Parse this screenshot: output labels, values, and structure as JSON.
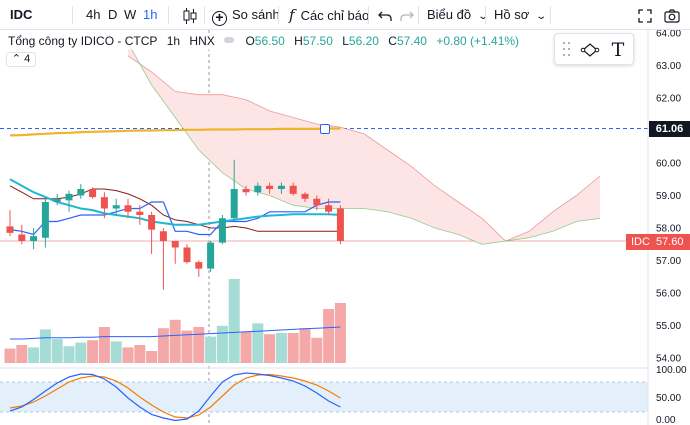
{
  "toolbar": {
    "symbol": "IDC",
    "intervals": [
      "4h",
      "D",
      "W",
      "1h"
    ],
    "active_interval": "1h",
    "compare_label": "So sánh",
    "indicators_label": "Các chỉ báo",
    "chart_type_label": "Biểu đồ",
    "profile_label": "Hồ sơ"
  },
  "legend": {
    "title": "Tổng công ty IDICO - CTCP",
    "interval": "1h",
    "exchange": "HNX",
    "o_key": "O",
    "o_val": "56.50",
    "h_key": "H",
    "h_val": "57.50",
    "l_key": "L",
    "l_val": "56.20",
    "c_key": "C",
    "c_val": "57.40",
    "change": "+0.80 (+1.41%)",
    "collapse": "4"
  },
  "price_axis": [
    "64.00",
    "63.00",
    "62.00",
    "61.00",
    "60.00",
    "59.00",
    "58.00",
    "57.00",
    "56.00",
    "55.00",
    "54.00"
  ],
  "osc_axis": [
    "100.00",
    "50.00",
    "0.00"
  ],
  "badges": {
    "last_line": "61.06",
    "symbol": "IDC",
    "current": "57.60"
  },
  "colors": {
    "up": "#26a69a",
    "down": "#ef5350",
    "accent": "#2962ff",
    "cloud_red": "#fde5e5",
    "cloud_green": "#d9efe8",
    "ma_long": "#f0b429",
    "ma_short": "#1fb6d8",
    "tenkan": "#2962ff",
    "kijun": "#8b1a1a"
  },
  "chart_data": {
    "type": "candlestick",
    "candles": [
      {
        "o": 58.05,
        "h": 58.55,
        "l": 57.75,
        "c": 57.85
      },
      {
        "o": 57.8,
        "h": 58.1,
        "l": 57.5,
        "c": 57.6
      },
      {
        "o": 57.6,
        "h": 58.0,
        "l": 57.35,
        "c": 57.75
      },
      {
        "o": 57.7,
        "h": 58.9,
        "l": 57.4,
        "c": 58.8
      },
      {
        "o": 58.8,
        "h": 59.05,
        "l": 58.7,
        "c": 58.9
      },
      {
        "o": 58.85,
        "h": 59.15,
        "l": 58.5,
        "c": 59.05
      },
      {
        "o": 59.0,
        "h": 59.35,
        "l": 58.9,
        "c": 59.2
      },
      {
        "o": 59.2,
        "h": 59.25,
        "l": 58.9,
        "c": 58.95
      },
      {
        "o": 58.95,
        "h": 59.1,
        "l": 58.3,
        "c": 58.6
      },
      {
        "o": 58.6,
        "h": 58.9,
        "l": 58.4,
        "c": 58.7
      },
      {
        "o": 58.7,
        "h": 58.9,
        "l": 58.3,
        "c": 58.5
      },
      {
        "o": 58.5,
        "h": 58.7,
        "l": 58.1,
        "c": 58.4
      },
      {
        "o": 58.4,
        "h": 58.5,
        "l": 57.2,
        "c": 57.95
      },
      {
        "o": 57.9,
        "h": 58.0,
        "l": 56.1,
        "c": 57.6
      },
      {
        "o": 57.6,
        "h": 57.6,
        "l": 56.9,
        "c": 57.4
      },
      {
        "o": 57.4,
        "h": 57.5,
        "l": 56.9,
        "c": 56.95
      },
      {
        "o": 56.95,
        "h": 57.0,
        "l": 56.5,
        "c": 56.75
      },
      {
        "o": 56.75,
        "h": 57.6,
        "l": 56.65,
        "c": 57.55
      },
      {
        "o": 57.55,
        "h": 58.4,
        "l": 57.5,
        "c": 58.3
      },
      {
        "o": 58.3,
        "h": 60.1,
        "l": 58.2,
        "c": 59.2
      },
      {
        "o": 59.2,
        "h": 59.3,
        "l": 59.0,
        "c": 59.1
      },
      {
        "o": 59.1,
        "h": 59.4,
        "l": 59.0,
        "c": 59.3
      },
      {
        "o": 59.3,
        "h": 59.4,
        "l": 59.05,
        "c": 59.2
      },
      {
        "o": 59.2,
        "h": 59.4,
        "l": 59.05,
        "c": 59.3
      },
      {
        "o": 59.3,
        "h": 59.4,
        "l": 59.0,
        "c": 59.05
      },
      {
        "o": 59.05,
        "h": 59.1,
        "l": 58.8,
        "c": 58.9
      },
      {
        "o": 58.9,
        "h": 59.0,
        "l": 58.55,
        "c": 58.7
      },
      {
        "o": 58.7,
        "h": 58.9,
        "l": 58.4,
        "c": 58.5
      },
      {
        "o": 58.6,
        "h": 58.7,
        "l": 57.5,
        "c": 57.6
      }
    ],
    "volume": [
      1.2,
      1.5,
      1.3,
      2.8,
      2.0,
      1.4,
      1.7,
      1.9,
      3.0,
      1.8,
      1.3,
      1.5,
      1.0,
      2.9,
      3.6,
      2.7,
      3.0,
      2.2,
      3.1,
      7.0,
      2.6,
      3.3,
      2.4,
      2.5,
      2.5,
      2.9,
      2.1,
      4.5,
      5.0
    ],
    "volume_ma": [
      2.0,
      2.0,
      2.05,
      2.1,
      2.1,
      2.1,
      2.15,
      2.15,
      2.2,
      2.2,
      2.2,
      2.2,
      2.2,
      2.25,
      2.3,
      2.35,
      2.4,
      2.45,
      2.5,
      2.55,
      2.6,
      2.65,
      2.7,
      2.75,
      2.8,
      2.85,
      2.9,
      2.95,
      3.0
    ],
    "ma_long": [
      60.85,
      60.86,
      60.88,
      60.9,
      60.92,
      60.93,
      60.95,
      60.96,
      60.97,
      60.98,
      60.99,
      61.0,
      61.0,
      61.01,
      61.01,
      61.02,
      61.02,
      61.03,
      61.03,
      61.03,
      61.04,
      61.04,
      61.04,
      61.05,
      61.05,
      61.05,
      61.05,
      61.06,
      61.06
    ],
    "ma_short": [
      59.5,
      59.3,
      59.1,
      58.95,
      58.8,
      58.7,
      58.6,
      58.55,
      58.45,
      58.4,
      58.35,
      58.3,
      58.2,
      58.15,
      58.1,
      58.1,
      58.1,
      58.15,
      58.2,
      58.25,
      58.3,
      58.35,
      58.38,
      58.4,
      58.42,
      58.42,
      58.42,
      58.42,
      58.4
    ],
    "tenkan": [
      57.95,
      57.9,
      57.8,
      58.2,
      58.2,
      58.3,
      58.4,
      58.4,
      58.4,
      58.5,
      58.6,
      58.6,
      58.8,
      58.8,
      57.9,
      57.9,
      57.8,
      57.8,
      58.2,
      58.2,
      58.2,
      58.3,
      58.5,
      58.5,
      58.5,
      58.5,
      58.7,
      58.8,
      58.8
    ],
    "kijun": [
      59.3,
      59.1,
      58.9,
      58.9,
      58.9,
      58.95,
      59.05,
      59.2,
      59.2,
      59.15,
      59.05,
      58.9,
      58.7,
      58.4,
      58.25,
      58.2,
      58.1,
      58.0,
      58.0,
      58.05,
      58.0,
      57.9,
      57.9,
      57.9,
      57.9,
      57.9,
      57.9,
      57.9,
      57.9
    ],
    "cloud_upper_x": [
      10,
      12,
      14,
      16,
      18,
      20,
      22,
      24,
      26,
      28,
      30,
      32,
      34,
      36,
      38,
      40,
      42,
      44,
      46,
      48,
      50
    ],
    "cloud_span_a": [
      63.3,
      62.8,
      62.2,
      62.1,
      62.1,
      61.95,
      61.6,
      61.4,
      61.2,
      61.1,
      60.9,
      60.4,
      59.9,
      59.3,
      58.8,
      58.3,
      57.6,
      57.9,
      58.5,
      59.0,
      59.6
    ],
    "cloud_span_b": [
      63.7,
      62.4,
      61.4,
      60.4,
      59.7,
      59.2,
      59.0,
      58.7,
      58.6,
      58.6,
      58.6,
      58.5,
      58.3,
      58.0,
      57.8,
      57.5,
      57.6,
      57.7,
      57.9,
      58.2,
      58.3
    ],
    "oscillator": {
      "k": [
        22,
        30,
        45,
        62,
        78,
        90,
        96,
        95,
        86,
        70,
        48,
        30,
        15,
        8,
        3,
        6,
        22,
        52,
        80,
        94,
        98,
        96,
        93,
        88,
        82,
        72,
        58,
        42,
        30
      ],
      "d": [
        28,
        32,
        40,
        52,
        66,
        80,
        88,
        92,
        90,
        82,
        68,
        50,
        34,
        20,
        10,
        8,
        14,
        30,
        52,
        74,
        88,
        94,
        95,
        92,
        88,
        82,
        74,
        62,
        48
      ],
      "band": [
        20,
        80
      ],
      "ylim": [
        0,
        100
      ]
    },
    "ylim": [
      53.85,
      64.1
    ]
  }
}
